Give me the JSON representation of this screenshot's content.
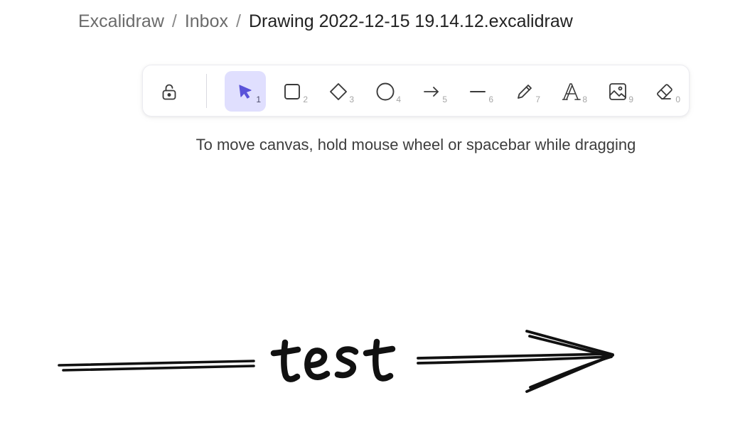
{
  "breadcrumb": {
    "items": [
      "Excalidraw",
      "Inbox"
    ],
    "separator": "/",
    "current": "Drawing 2022-12-15 19.14.12.excalidraw"
  },
  "toolbar": {
    "lock": {
      "icon": "unlock-icon"
    },
    "tools": [
      {
        "name": "selection",
        "icon": "pointer-arrow-icon",
        "shortcut": "1",
        "active": true
      },
      {
        "name": "rectangle",
        "icon": "square-icon",
        "shortcut": "2",
        "active": false
      },
      {
        "name": "diamond",
        "icon": "diamond-icon",
        "shortcut": "3",
        "active": false
      },
      {
        "name": "ellipse",
        "icon": "circle-icon",
        "shortcut": "4",
        "active": false
      },
      {
        "name": "arrow",
        "icon": "arrow-right-icon",
        "shortcut": "5",
        "active": false
      },
      {
        "name": "line",
        "icon": "line-icon",
        "shortcut": "6",
        "active": false
      },
      {
        "name": "draw",
        "icon": "pencil-icon",
        "shortcut": "7",
        "active": false
      },
      {
        "name": "text",
        "icon": "text-icon",
        "shortcut": "8",
        "active": false
      },
      {
        "name": "image",
        "icon": "image-icon",
        "shortcut": "9",
        "active": false
      },
      {
        "name": "eraser",
        "icon": "eraser-icon",
        "shortcut": "0",
        "active": false
      }
    ]
  },
  "hint": "To move canvas, hold mouse wheel or spacebar while dragging",
  "canvas": {
    "text_element": "test"
  },
  "colors": {
    "accent": "#6965db",
    "active_bg": "#e0dffe",
    "stroke": "#1e1e1e"
  }
}
